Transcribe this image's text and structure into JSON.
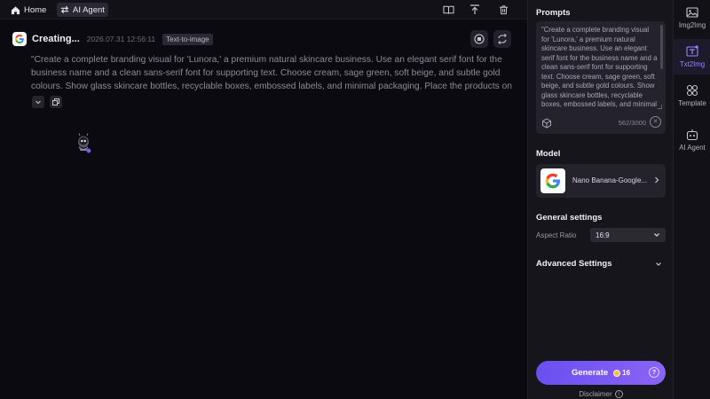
{
  "topbar": {
    "home_label": "Home",
    "agent_label": "AI Agent",
    "tools": [
      "book-icon",
      "upload-icon",
      "trash-icon"
    ]
  },
  "generation": {
    "title": "Creating...",
    "timestamp": "2026.07.31 12:56:11",
    "tag": "Text-to-image",
    "prompt": "\"Create a complete branding visual for 'Lunora,' a premium natural skincare business. Use an elegant serif font for the business name and a clean sans-serif font for supporting text. Choose cream, sage green, soft beige, and subtle gold colours. Show glass skincare bottles, recyclable boxes, embossed labels, and minimal packaging. Place the products on ..."
  },
  "panel": {
    "prompts_label": "Prompts",
    "prompt_text": "\"Create a complete branding visual for 'Lunora,' a premium natural skincare business. Use an elegant serif font for the business name and a clean sans-serif font for supporting text. Choose cream, sage green, soft beige, and subtle gold colours. Show glass skincare bottles, recyclable boxes, embossed labels, and minimal packaging.",
    "char_count": "562/3000",
    "model_label": "Model",
    "model_name": "Nano Banana-Google...",
    "general_label": "General settings",
    "aspect_label": "Aspect Ratio",
    "aspect_value": "16:9",
    "advanced_label": "Advanced Settings",
    "generate_label": "Generate",
    "generate_cost": "16",
    "disclaimer": "Disclaimer"
  },
  "rail": {
    "items": [
      {
        "label": "Img2Img",
        "icon": "image-icon"
      },
      {
        "label": "Txt2Img",
        "icon": "text-image-icon"
      },
      {
        "label": "Template",
        "icon": "grid-icon"
      },
      {
        "label": "AI Agent",
        "icon": "robot-icon"
      }
    ],
    "active": "Txt2Img"
  },
  "colors": {
    "accent": "#7b5cf5",
    "background": "#0b0a10",
    "panel": "#16151c"
  }
}
